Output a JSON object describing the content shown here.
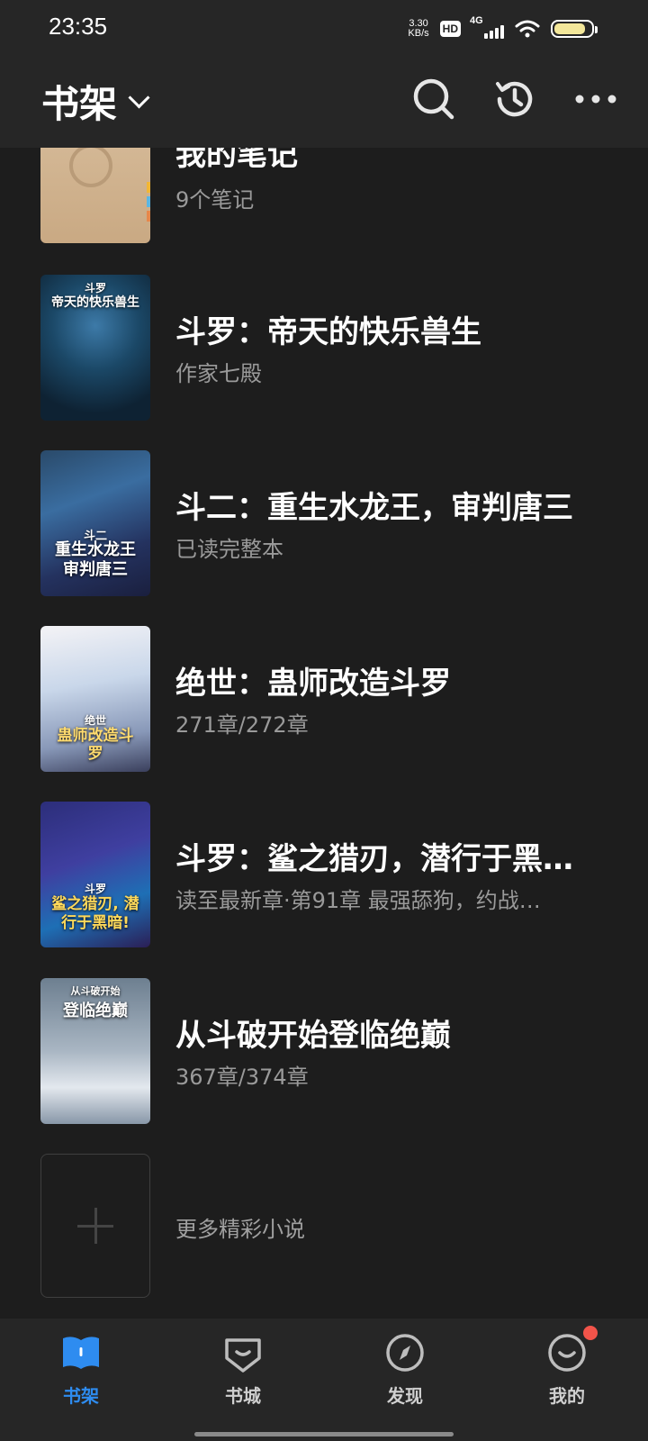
{
  "status": {
    "time": "23:35",
    "speed_value": "3.30",
    "speed_unit": "KB/s",
    "hd": "HD",
    "network": "4G",
    "battery_level": 0.85,
    "battery_color": "#f3e79a"
  },
  "header": {
    "title": "书架",
    "icons": [
      "search-icon",
      "history-icon",
      "more-icon"
    ]
  },
  "notes": {
    "title": "我的笔记",
    "subtitle": "9个笔记"
  },
  "books": [
    {
      "title": "斗罗：帝天的快乐兽生",
      "subtitle": "作家七殿",
      "cover_top": "斗罗",
      "cover_main": "帝天的快乐兽生"
    },
    {
      "title": "斗二：重生水龙王，审判唐三",
      "subtitle": "已读完整本",
      "cover_top": "斗二",
      "cover_main": "重生水龙王 审判唐三"
    },
    {
      "title": "绝世：蛊师改造斗罗",
      "subtitle": "271章/272章",
      "cover_top": "绝世",
      "cover_main": "蛊师改造斗罗"
    },
    {
      "title": "斗罗：鲨之猎刃，潜行于黑…",
      "subtitle": "读至最新章·第91章 最强舔狗，约战…",
      "cover_top": "斗罗",
      "cover_main": "鲨之猎刃, 潜行于黑暗!"
    },
    {
      "title": "从斗破开始登临绝巅",
      "subtitle": "367章/374章",
      "cover_top": "从斗破开始",
      "cover_main": "登临绝巅"
    }
  ],
  "more": {
    "label": "更多精彩小说"
  },
  "nav": {
    "items": [
      {
        "label": "书架",
        "icon": "bookshelf-icon",
        "active": true
      },
      {
        "label": "书城",
        "icon": "bookstore-icon",
        "active": false
      },
      {
        "label": "发现",
        "icon": "discover-icon",
        "active": false
      },
      {
        "label": "我的",
        "icon": "profile-icon",
        "active": false
      }
    ],
    "accent": "#2e8cf0",
    "badge_color": "#f2544a"
  }
}
